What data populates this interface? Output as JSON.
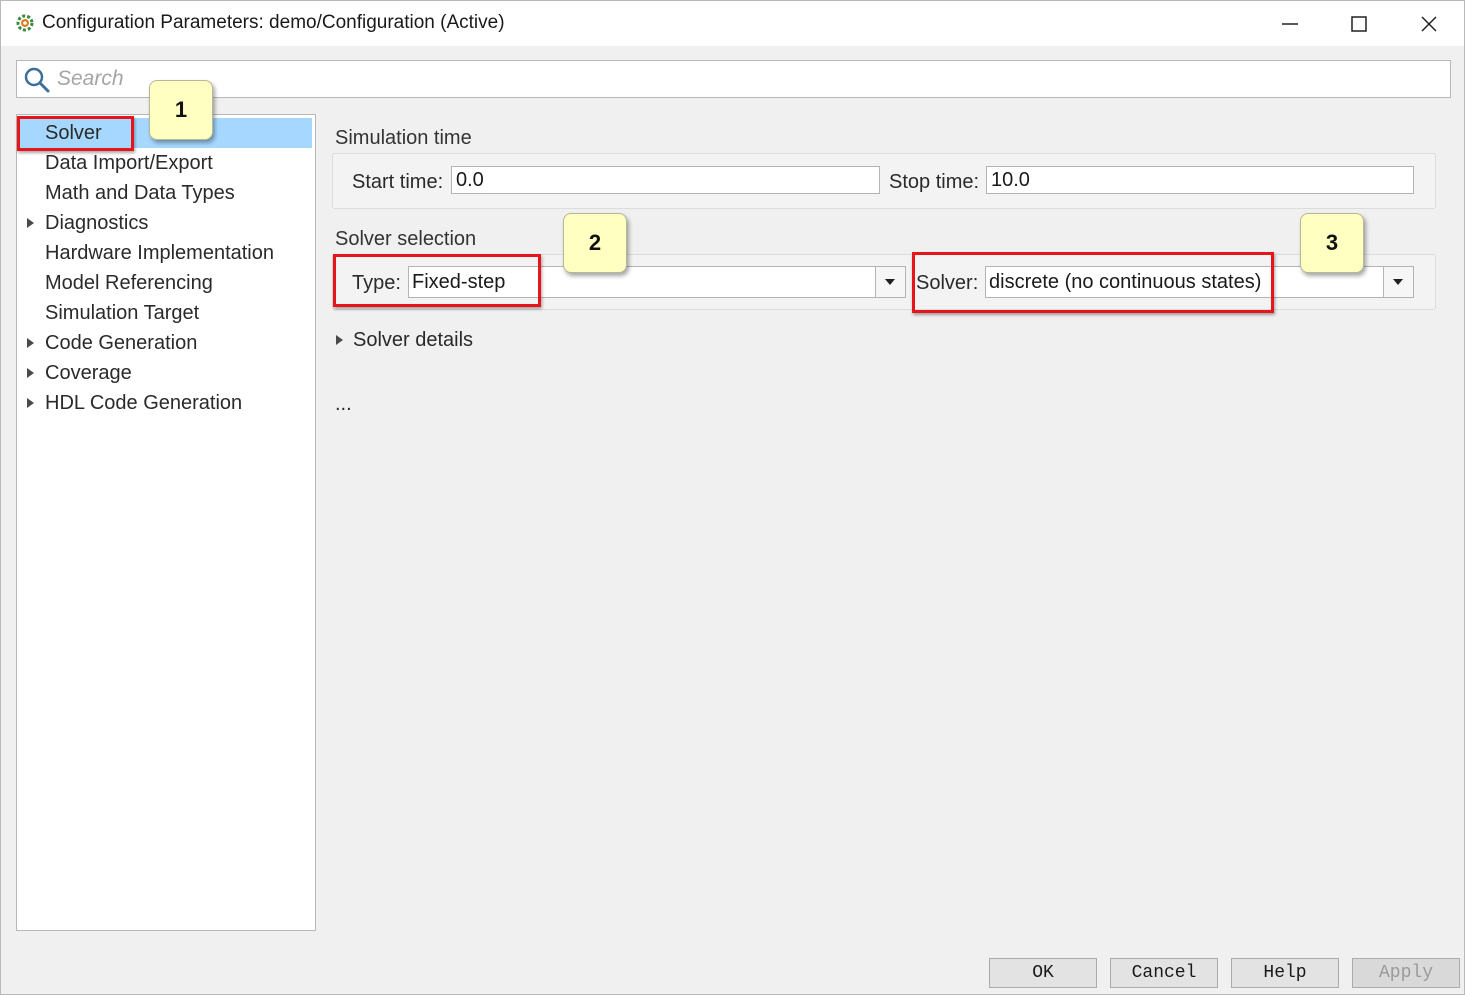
{
  "window": {
    "title": "Configuration Parameters: demo/Configuration (Active)"
  },
  "search": {
    "placeholder": "Search"
  },
  "tree": {
    "items": [
      {
        "label": "Solver",
        "selected": true,
        "expandable": false
      },
      {
        "label": "Data Import/Export",
        "selected": false,
        "expandable": false
      },
      {
        "label": "Math and Data Types",
        "selected": false,
        "expandable": false
      },
      {
        "label": "Diagnostics",
        "selected": false,
        "expandable": true
      },
      {
        "label": "Hardware Implementation",
        "selected": false,
        "expandable": false
      },
      {
        "label": "Model Referencing",
        "selected": false,
        "expandable": false
      },
      {
        "label": "Simulation Target",
        "selected": false,
        "expandable": false
      },
      {
        "label": "Code Generation",
        "selected": false,
        "expandable": true
      },
      {
        "label": "Coverage",
        "selected": false,
        "expandable": true
      },
      {
        "label": "HDL Code Generation",
        "selected": false,
        "expandable": true
      }
    ]
  },
  "simulation_time": {
    "title": "Simulation time",
    "start_label": "Start time:",
    "start_value": "0.0",
    "stop_label": "Stop time:",
    "stop_value": "10.0"
  },
  "solver_selection": {
    "title": "Solver selection",
    "type_label": "Type:",
    "type_value": "Fixed-step",
    "solver_label": "Solver:",
    "solver_value": "discrete (no continuous states)"
  },
  "solver_details": {
    "label": "Solver details",
    "ellipsis": "..."
  },
  "callouts": [
    "1",
    "2",
    "3"
  ],
  "buttons": {
    "ok": "OK",
    "cancel": "Cancel",
    "help": "Help",
    "apply": "Apply"
  },
  "colors": {
    "selection": "#a6d8ff",
    "highlight_box": "#e8141b",
    "callout_fill": "#ffffc2"
  }
}
